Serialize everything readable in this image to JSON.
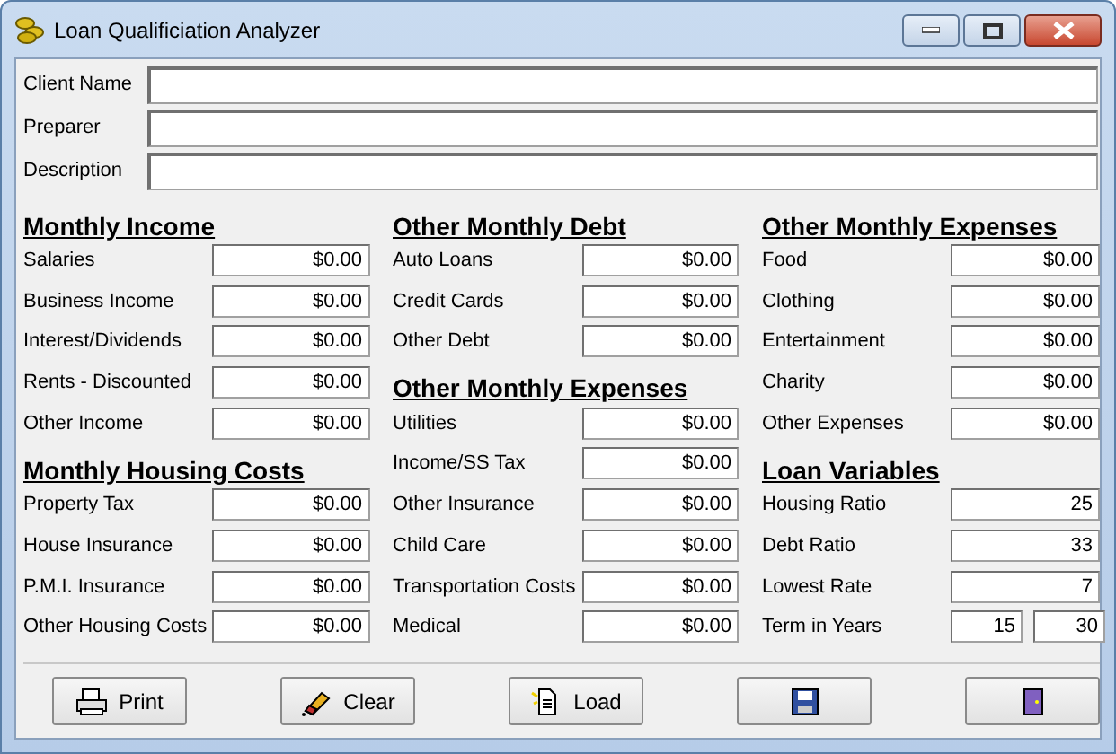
{
  "window": {
    "title": "Loan Qualificiation Analyzer"
  },
  "header_fields": [
    {
      "label": "Client Name"
    },
    {
      "label": "Preparer"
    },
    {
      "label": "Description"
    }
  ],
  "columns": [
    {
      "sections": [
        {
          "heading": "Monthly Income",
          "rows": [
            {
              "label": "Salaries",
              "values": [
                "$0.00"
              ]
            },
            {
              "label": "Business Income",
              "values": [
                "$0.00"
              ]
            },
            {
              "label": "Interest/Dividends",
              "values": [
                "$0.00"
              ]
            },
            {
              "label": "Rents - Discounted",
              "values": [
                "$0.00"
              ]
            },
            {
              "label": "Other Income",
              "values": [
                "$0.00"
              ]
            }
          ]
        },
        {
          "heading": "Monthly Housing Costs",
          "rows": [
            {
              "label": "Property Tax",
              "values": [
                "$0.00"
              ]
            },
            {
              "label": "House Insurance",
              "values": [
                "$0.00"
              ]
            },
            {
              "label": "P.M.I. Insurance",
              "values": [
                "$0.00"
              ]
            },
            {
              "label": "Other Housing Costs",
              "values": [
                "$0.00"
              ]
            }
          ]
        }
      ]
    },
    {
      "sections": [
        {
          "heading": "Other Monthly Debt",
          "rows": [
            {
              "label": "Auto Loans",
              "values": [
                "$0.00"
              ]
            },
            {
              "label": "Credit Cards",
              "values": [
                "$0.00"
              ]
            },
            {
              "label": "Other Debt",
              "values": [
                "$0.00"
              ]
            }
          ]
        },
        {
          "heading": "Other Monthly Expenses",
          "rows": [
            {
              "label": "Utilities",
              "values": [
                "$0.00"
              ]
            },
            {
              "label": "Income/SS Tax",
              "values": [
                "$0.00"
              ]
            },
            {
              "label": "Other Insurance",
              "values": [
                "$0.00"
              ]
            },
            {
              "label": "Child Care",
              "values": [
                "$0.00"
              ]
            },
            {
              "label": "Transportation Costs",
              "values": [
                "$0.00"
              ]
            },
            {
              "label": "Medical",
              "values": [
                "$0.00"
              ]
            }
          ]
        }
      ]
    },
    {
      "sections": [
        {
          "heading": "Other Monthly Expenses",
          "rows": [
            {
              "label": "Food",
              "values": [
                "$0.00"
              ]
            },
            {
              "label": "Clothing",
              "values": [
                "$0.00"
              ]
            },
            {
              "label": "Entertainment",
              "values": [
                "$0.00"
              ]
            },
            {
              "label": "Charity",
              "values": [
                "$0.00"
              ]
            },
            {
              "label": "Other Expenses",
              "values": [
                "$0.00"
              ]
            }
          ]
        },
        {
          "heading": "Loan Variables",
          "rows": [
            {
              "label": "Housing Ratio",
              "values": [
                "25"
              ]
            },
            {
              "label": "Debt Ratio",
              "values": [
                "33"
              ]
            },
            {
              "label": "Lowest Rate",
              "values": [
                "7"
              ]
            },
            {
              "label": "Term in Years",
              "values": [
                "15",
                "30"
              ]
            }
          ]
        }
      ]
    }
  ],
  "buttons": [
    {
      "label": "Print",
      "kind": "print"
    },
    {
      "label": "Clear",
      "kind": "clear"
    },
    {
      "label": "Load",
      "kind": "load"
    },
    {
      "kind": "save"
    },
    {
      "kind": "exit"
    }
  ]
}
